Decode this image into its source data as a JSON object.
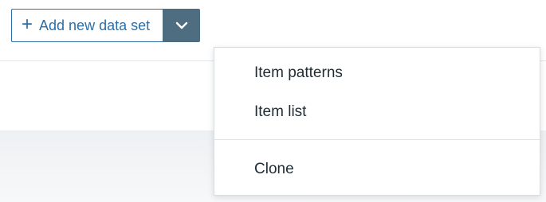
{
  "toolbar": {
    "add_button_label": "Add new data set",
    "add_button_icon": "plus-icon",
    "toggle_icon": "chevron-down-icon"
  },
  "dropdown": {
    "items": [
      {
        "label": "Item patterns"
      },
      {
        "label": "Item list"
      },
      {
        "label": "Clone"
      }
    ]
  },
  "colors": {
    "accent": "#2b6ea8",
    "toggle_bg": "#4f6d80",
    "text": "#1f2c33"
  }
}
